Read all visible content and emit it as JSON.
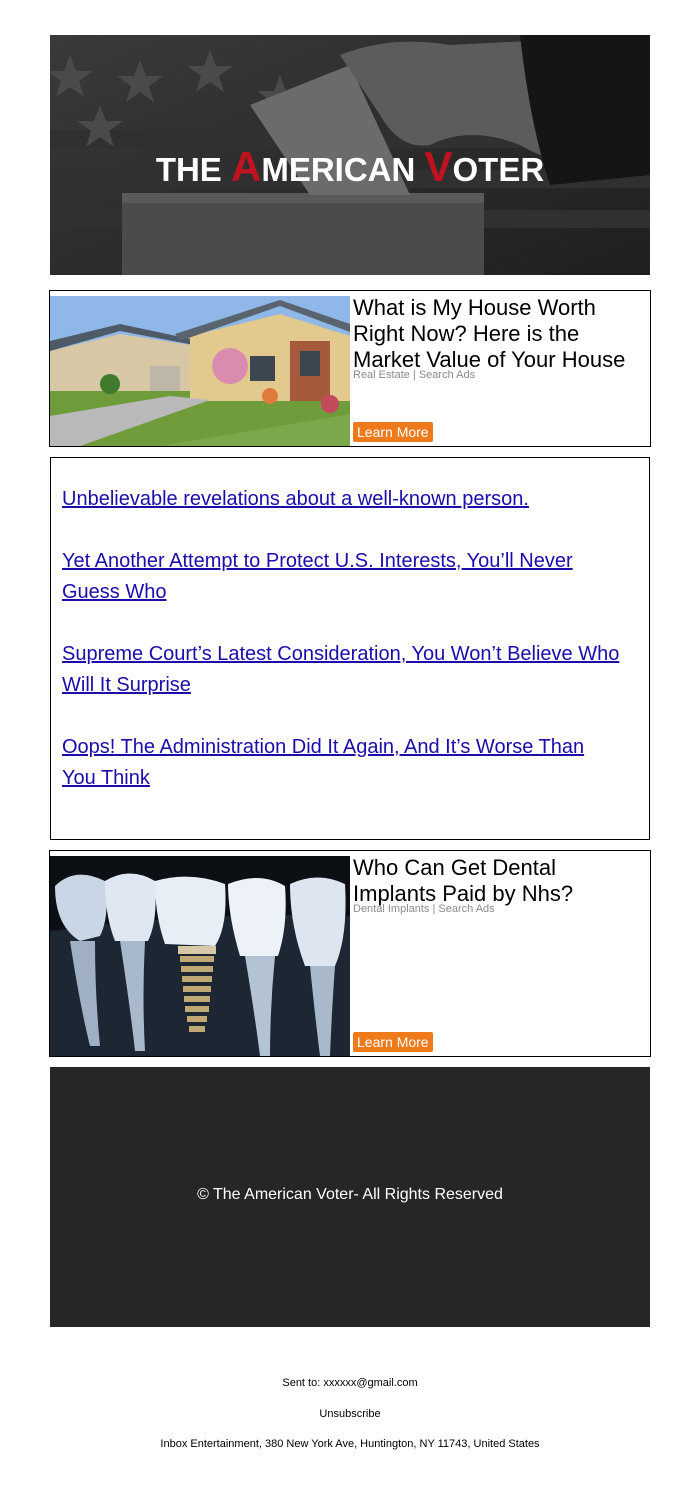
{
  "header": {
    "logo_part1": "THE ",
    "logo_a": "A",
    "logo_part2": "MERICAN ",
    "logo_v": "V",
    "logo_part3": "OTER"
  },
  "ads": [
    {
      "title": "What is My House Worth Right Now? Here is the Market Value of Your House",
      "source": "Real Estate | Search Ads",
      "button": "Learn More",
      "image": "suburban-houses-photo"
    },
    {
      "title": "Who Can Get Dental Implants Paid by Nhs?",
      "source": "Dental Implants | Search Ads",
      "button": "Learn More",
      "image": "dental-implant-photo"
    }
  ],
  "links": [
    "Unbelievable revelations about a well-known person.",
    "Yet Another Attempt to Protect U.S. Interests, You’ll Never Guess Who",
    "Supreme Court’s Latest Consideration, You Won’t Believe Who Will It Surprise",
    "Oops! The Administration Did It Again, And It’s Worse Than You Think"
  ],
  "footer": {
    "copyright": "© The American Voter- All Rights Reserved",
    "sent_to_label": "Sent to: ",
    "sent_to_email": "xxxxxx@gmail.com",
    "unsubscribe": "Unsubscribe",
    "address": "Inbox Entertainment, 380 New York Ave, Huntington, NY 11743, United States"
  },
  "colors": {
    "accent_red": "#c1121f",
    "button_orange": "#ee7a1c",
    "link_blue": "#1a0dab",
    "footer_bg": "#262626"
  }
}
